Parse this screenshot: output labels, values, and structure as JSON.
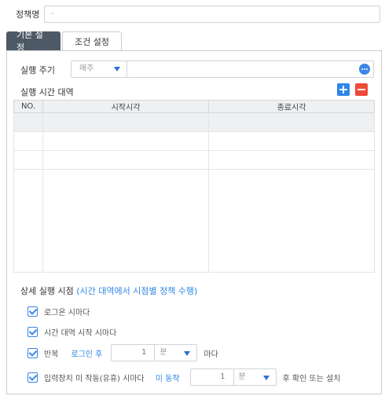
{
  "policy": {
    "label": "정책명",
    "value": "-"
  },
  "tabs": [
    {
      "label": "기본 설정",
      "active": true
    },
    {
      "label": "조건 설정",
      "active": false
    }
  ],
  "cycle": {
    "label": "실행 주기",
    "selected": "매주",
    "icon": "more-icon"
  },
  "time_range": {
    "label": "실행 시간 대역",
    "add_icon": "plus-icon",
    "remove_icon": "minus-icon",
    "columns": [
      "NO.",
      "시작시각",
      "종료시각"
    ]
  },
  "detail": {
    "title": "상세 실행 시점",
    "note": "(시간 대역에서 시점별 정책 수행)",
    "options": [
      {
        "label": "로그온 시마다",
        "checked": true
      },
      {
        "label": "시간 대역 시작 시마다",
        "checked": true
      },
      {
        "label": "반복",
        "checked": true,
        "keyword": "로그인 후",
        "value": "1",
        "unit": "분",
        "suffix": "마다"
      },
      {
        "label": "입력장치 미 작동(유휴) 시마다",
        "checked": true,
        "keyword": "미 동작",
        "value": "1",
        "unit": "분",
        "suffix": "후 확인 또는 설치"
      }
    ]
  },
  "colors": {
    "accent": "#2f86e6",
    "danger": "#ef4a3a",
    "tab_active": "#4d5965"
  }
}
